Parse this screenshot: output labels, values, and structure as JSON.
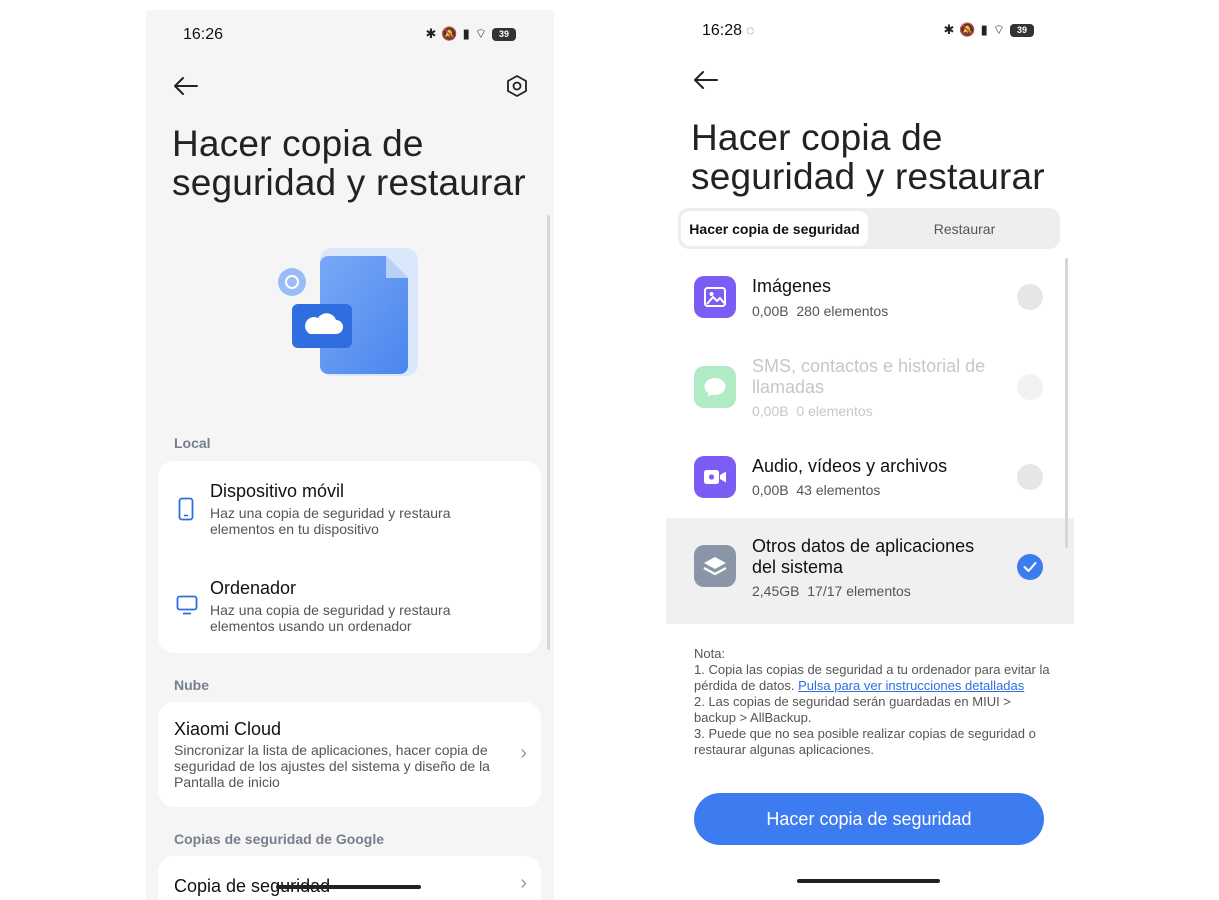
{
  "left": {
    "status": {
      "time": "16:26",
      "battery": "39"
    },
    "title": "Hacer copia de seguridad y restaurar",
    "local_label": "Local",
    "local_items": [
      {
        "title": "Dispositivo móvil",
        "desc": "Haz una copia de seguridad y restaura elementos en tu dispositivo"
      },
      {
        "title": "Ordenador",
        "desc": "Haz una copia de seguridad y restaura elementos usando un ordenador"
      }
    ],
    "cloud_label": "Nube",
    "cloud_item": {
      "title": "Xiaomi Cloud",
      "desc": "Sincronizar la lista de aplicaciones, hacer copia de seguridad de los ajustes del sistema y diseño de la Pantalla de inicio"
    },
    "google_label": "Copias de seguridad de Google",
    "google_item": {
      "title": "Copia de seguridad"
    }
  },
  "right": {
    "status": {
      "time": "16:28",
      "battery": "39"
    },
    "title": "Hacer copia de seguridad y restaurar",
    "tabs": [
      {
        "label": "Hacer copia de seguridad",
        "active": true
      },
      {
        "label": "Restaurar",
        "active": false
      }
    ],
    "categories": [
      {
        "name": "Imágenes",
        "size": "0,00B",
        "count": "280 elementos",
        "checked": false,
        "enabled": true,
        "icon": "image-icon",
        "color": "#7b5cf5"
      },
      {
        "name": "SMS, contactos e historial de llamadas",
        "size": "0,00B",
        "count": "0 elementos",
        "checked": false,
        "enabled": false,
        "icon": "message-icon",
        "color": "#3ccf72"
      },
      {
        "name": "Audio, vídeos y archivos",
        "size": "0,00B",
        "count": "43 elementos",
        "checked": false,
        "enabled": true,
        "icon": "video-icon",
        "color": "#7b5cf5"
      },
      {
        "name": "Otros datos de aplicaciones del sistema",
        "size": "2,45GB",
        "count": "17/17 elementos",
        "checked": true,
        "enabled": true,
        "icon": "layers-icon",
        "color": "#8a96a8"
      }
    ],
    "note": {
      "label": "Nota:",
      "line1_text": "1. Copia las copias de seguridad a tu ordenador para evitar la pérdida de datos. ",
      "line1_link": "Pulsa para ver instrucciones detalladas",
      "line2": "2. Las copias de seguridad serán guardadas en MIUI > backup > AllBackup.",
      "line3": "3. Puede que no sea posible realizar copias de seguridad o restaurar algunas aplicaciones."
    },
    "primary_button": "Hacer copia de seguridad"
  },
  "colors": {
    "accent": "#3d7cf0",
    "purple_icon": "#7b5cf5",
    "green_icon": "#3ccf72",
    "gray_icon": "#8a96a8",
    "panel_bg": "#f5f5f5",
    "selected_row": "#f0f0f0"
  }
}
